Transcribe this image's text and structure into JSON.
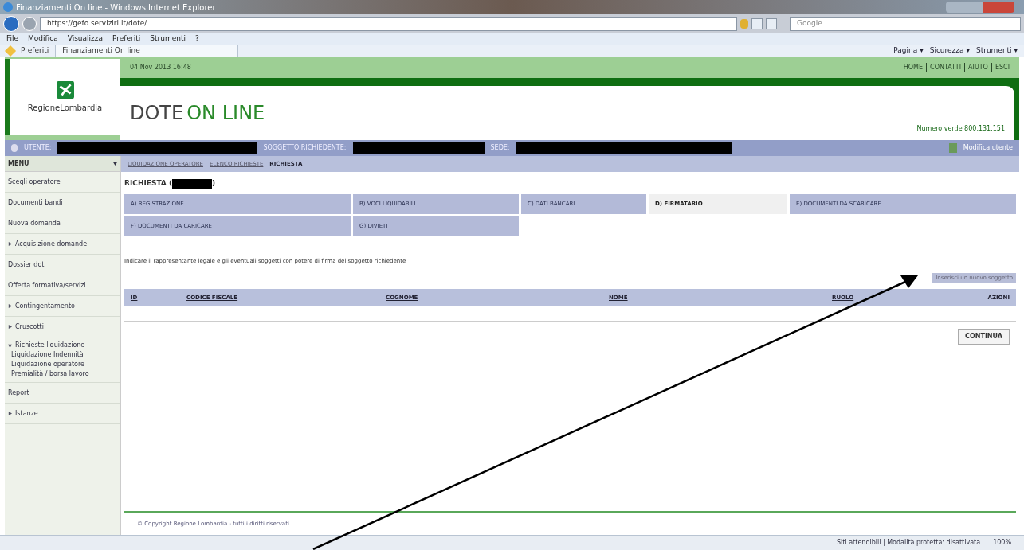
{
  "browser": {
    "title": "Finanziamenti On line - Windows Internet Explorer",
    "url": "https://gefo.servizirl.it/dote/",
    "search_placeholder": "Google",
    "menu": [
      "File",
      "Modifica",
      "Visualizza",
      "Preferiti",
      "Strumenti",
      "?"
    ],
    "favorites": "Preferiti",
    "tab": "Finanziamenti On line",
    "tools": [
      "Pagina ▾",
      "Sicurezza ▾",
      "Strumenti ▾"
    ]
  },
  "header": {
    "date": "04 Nov 2013 16:48",
    "links": [
      "HOME",
      "CONTATTI",
      "AIUTO",
      "ESCI"
    ],
    "logo_text": "RegioneLombardia",
    "app_title_1": "DOTE",
    "app_title_2": "ON LINE",
    "phone": "Numero verde 800.131.151"
  },
  "user_bar": {
    "labels": [
      "UTENTE:",
      "SOGGETTO RICHIEDENTE:",
      "SEDE:"
    ],
    "action": "Modifica utente"
  },
  "sidebar": {
    "title": "MENU",
    "items": [
      {
        "label": "Scegli operatore",
        "kind": "link"
      },
      {
        "label": "Documenti bandi",
        "kind": "link"
      },
      {
        "label": "Nuova domanda",
        "kind": "link"
      },
      {
        "label": "Acquisizione domande",
        "kind": "group",
        "expanded": false
      },
      {
        "label": "Dossier doti",
        "kind": "link"
      },
      {
        "label": "Offerta formativa/servizi",
        "kind": "link"
      },
      {
        "label": "Contingentamento",
        "kind": "group",
        "expanded": false
      },
      {
        "label": "Cruscotti",
        "kind": "group",
        "expanded": false
      },
      {
        "label": "Richieste liquidazione",
        "kind": "group",
        "expanded": true,
        "children": [
          {
            "label": "Liquidazione Indennità"
          },
          {
            "label": "Liquidazione operatore"
          },
          {
            "label": "Premialità / borsa lavoro"
          }
        ]
      },
      {
        "label": "Report",
        "kind": "link"
      },
      {
        "label": "Istanze",
        "kind": "group",
        "expanded": false
      }
    ]
  },
  "breadcrumb": [
    "LIQUIDAZIONE OPERATORE",
    "ELENCO RICHIESTE",
    "RICHIESTA"
  ],
  "page_title": "RICHIESTA (",
  "page_title_end": ")",
  "tabs": [
    {
      "label": "A) REGISTRAZIONE",
      "selected": false
    },
    {
      "label": "B) VOCI LIQUIDABILI",
      "selected": false
    },
    {
      "label": "C) DATI BANCARI",
      "selected": false
    },
    {
      "label": "D) FIRMATARIO",
      "selected": true
    },
    {
      "label": "E) DOCUMENTI DA SCARICARE",
      "selected": false
    },
    {
      "label": "F) DOCUMENTI DA CARICARE",
      "selected": false
    },
    {
      "label": "G) DIVIETI",
      "selected": false
    }
  ],
  "instruction": "Indicare il rappresentante legale e gli eventuali soggetti con potere di firma del soggetto richiedente",
  "add_button": "Inserisci un nuovo soggetto",
  "table": {
    "columns": [
      "ID",
      "CODICE FISCALE",
      "COGNOME",
      "NOME",
      "RUOLO",
      "AZIONI"
    ]
  },
  "continue_button": "CONTINUA",
  "footer": "© Copyright Regione Lombardia - tutti i diritti riservati",
  "status_bar": {
    "zone": "Siti attendibili | Modalità protetta: disattivata",
    "zoom": "100%"
  }
}
